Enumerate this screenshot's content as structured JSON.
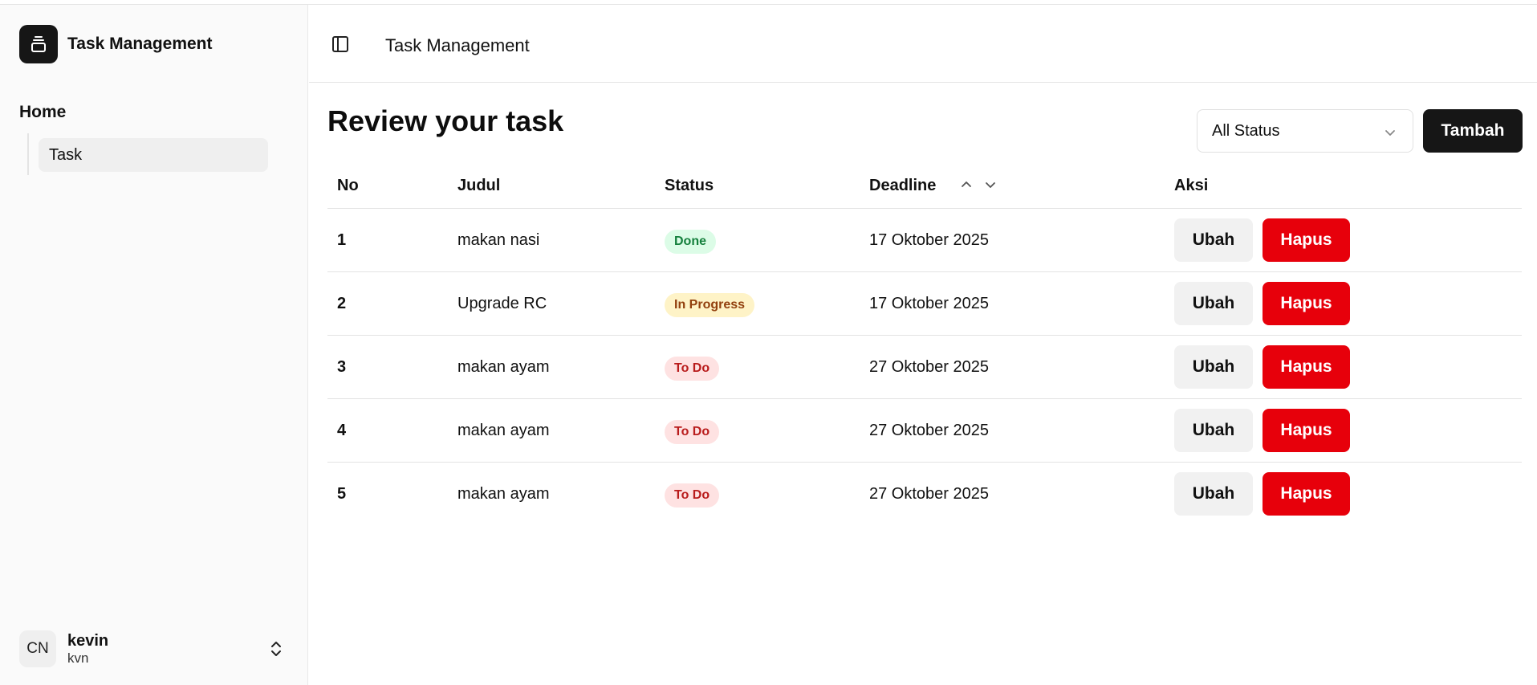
{
  "app": {
    "brand_title": "Task Management",
    "brand_icon": "layers-icon"
  },
  "sidebar": {
    "section_label": "Home",
    "items": [
      {
        "label": "Task",
        "active": true
      }
    ],
    "user": {
      "initials": "CN",
      "name": "kevin",
      "handle": "kvn"
    }
  },
  "header": {
    "title": "Task Management",
    "toggle_icon": "sidebar-toggle-icon"
  },
  "main": {
    "title": "Review your task",
    "filter": {
      "selected": "All Status"
    },
    "add_label": "Tambah"
  },
  "table": {
    "headers": {
      "no": "No",
      "title": "Judul",
      "status": "Status",
      "deadline": "Deadline",
      "actions": "Aksi"
    },
    "edit_label": "Ubah",
    "delete_label": "Hapus",
    "rows": [
      {
        "no": "1",
        "title": "makan nasi",
        "status": "Done",
        "deadline": "17 Oktober 2025"
      },
      {
        "no": "2",
        "title": "Upgrade RC",
        "status": "In Progress",
        "deadline": "17 Oktober 2025"
      },
      {
        "no": "3",
        "title": "makan ayam",
        "status": "To Do",
        "deadline": "27 Oktober 2025"
      },
      {
        "no": "4",
        "title": "makan ayam",
        "status": "To Do",
        "deadline": "27 Oktober 2025"
      },
      {
        "no": "5",
        "title": "makan ayam",
        "status": "To Do",
        "deadline": "27 Oktober 2025"
      }
    ]
  },
  "colors": {
    "primary": "#161616",
    "danger": "#e7000b",
    "done_bg": "#dcfce7",
    "done_text": "#15803d",
    "progress_bg": "#fef3c7",
    "progress_text": "#92400e",
    "todo_bg": "#fee2e2",
    "todo_text": "#b91c1c"
  }
}
